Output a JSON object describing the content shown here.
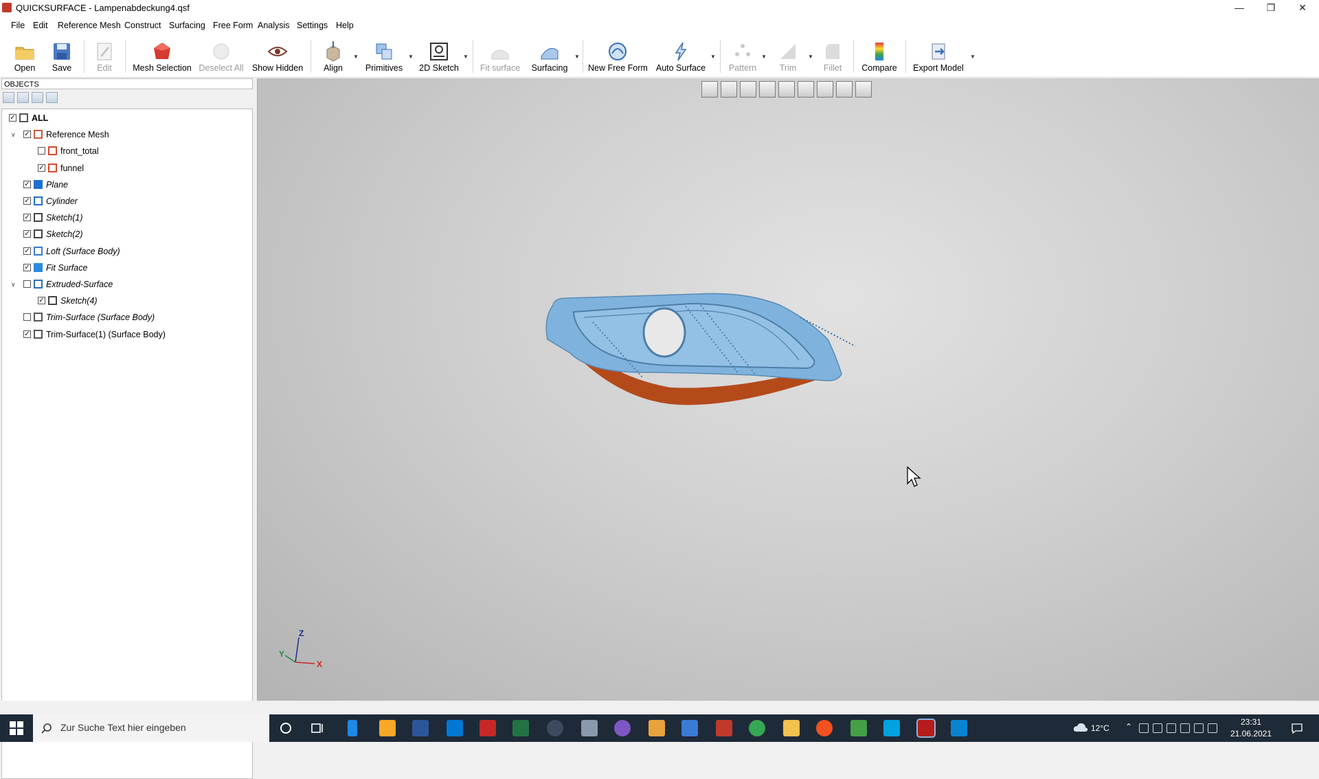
{
  "window": {
    "title": "QUICKSURFACE - Lampenabdeckung4.qsf"
  },
  "menu": [
    "File",
    "Edit",
    "Reference Mesh",
    "Construct",
    "Surfacing",
    "Free Form",
    "Analysis",
    "Settings",
    "Help"
  ],
  "toolbar": {
    "open": "Open",
    "save": "Save",
    "edit": "Edit",
    "mesh_selection": "Mesh Selection",
    "deselect_all": "Deselect All",
    "show_hidden": "Show Hidden",
    "align": "Align",
    "primitives": "Primitives",
    "sketch2d": "2D Sketch",
    "fit_surface": "Fit surface",
    "surfacing": "Surfacing",
    "new_free_form": "New Free Form",
    "auto_surface": "Auto Surface",
    "pattern": "Pattern",
    "trim": "Trim",
    "fillet": "Fillet",
    "compare": "Compare",
    "export_model": "Export Model"
  },
  "objects": {
    "header": "OBJECTS",
    "items": [
      {
        "label": "ALL",
        "checked": true,
        "bold": true,
        "italic": false,
        "icon": "list-icon"
      },
      {
        "label": "Reference Mesh",
        "checked": true,
        "italic": false,
        "icon": "mesh-icon",
        "expanded": true
      },
      {
        "label": "front_total",
        "checked": false,
        "italic": false,
        "icon": "mesh-part-icon"
      },
      {
        "label": "funnel",
        "checked": true,
        "italic": false,
        "icon": "mesh-part-icon"
      },
      {
        "label": "Plane",
        "checked": true,
        "italic": true,
        "icon": "plane-icon"
      },
      {
        "label": "Cylinder",
        "checked": true,
        "italic": true,
        "icon": "cylinder-icon"
      },
      {
        "label": "Sketch(1)",
        "checked": true,
        "italic": true,
        "icon": "sketch-icon"
      },
      {
        "label": "Sketch(2)",
        "checked": true,
        "italic": true,
        "icon": "sketch-icon"
      },
      {
        "label": "Loft (Surface Body)",
        "checked": true,
        "italic": true,
        "icon": "loft-icon"
      },
      {
        "label": "Fit Surface",
        "checked": true,
        "italic": true,
        "icon": "fit-surface-icon"
      },
      {
        "label": "Extruded-Surface",
        "checked": false,
        "italic": true,
        "icon": "extrude-icon",
        "expanded": true
      },
      {
        "label": "Sketch(4)",
        "checked": true,
        "italic": true,
        "icon": "sketch-icon"
      },
      {
        "label": "Trim-Surface (Surface Body)",
        "checked": false,
        "italic": true,
        "icon": "trim-icon"
      },
      {
        "label": "Trim-Surface(1) (Surface Body)",
        "checked": true,
        "italic": false,
        "icon": "trim-icon"
      }
    ]
  },
  "axes": {
    "z": "Z",
    "y": "Y",
    "x": "X"
  },
  "taskbar": {
    "search_placeholder": "Zur Suche Text hier eingeben",
    "weather": "12°C",
    "time": "23:31",
    "date": "21.06.2021"
  },
  "colors": {
    "model_blue": "#7fb2dc",
    "model_orange": "#b44a1a",
    "taskbar": "#1f2a38"
  }
}
